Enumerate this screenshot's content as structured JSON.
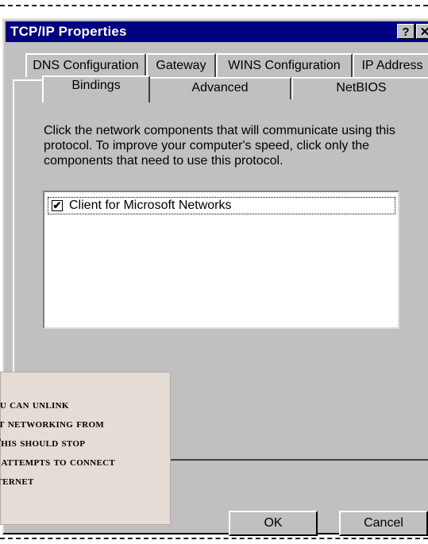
{
  "window": {
    "title": "TCP/IP Properties",
    "help_button": "?",
    "close_button": "✕"
  },
  "tabs": {
    "row_back": [
      "DNS Configuration",
      "Gateway",
      "WINS Configuration",
      "IP Address"
    ],
    "row_front": [
      "Bindings",
      "Advanced",
      "NetBIOS"
    ],
    "active": "Bindings"
  },
  "bindings": {
    "description": [
      "Click the network components that will communicate using this",
      "protocol. To improve your computer's speed, click only the",
      "components that need to use this protocol."
    ],
    "items": [
      {
        "label": "Client for Microsoft Networks",
        "checked": true,
        "check_glyph": "✔"
      }
    ]
  },
  "buttons": {
    "ok": "OK",
    "cancel": "Cancel"
  },
  "annotation": {
    "lines": [
      "ou can unlink",
      "ft networking from",
      "This should stop",
      "s attempts to connect",
      "iternet"
    ]
  }
}
